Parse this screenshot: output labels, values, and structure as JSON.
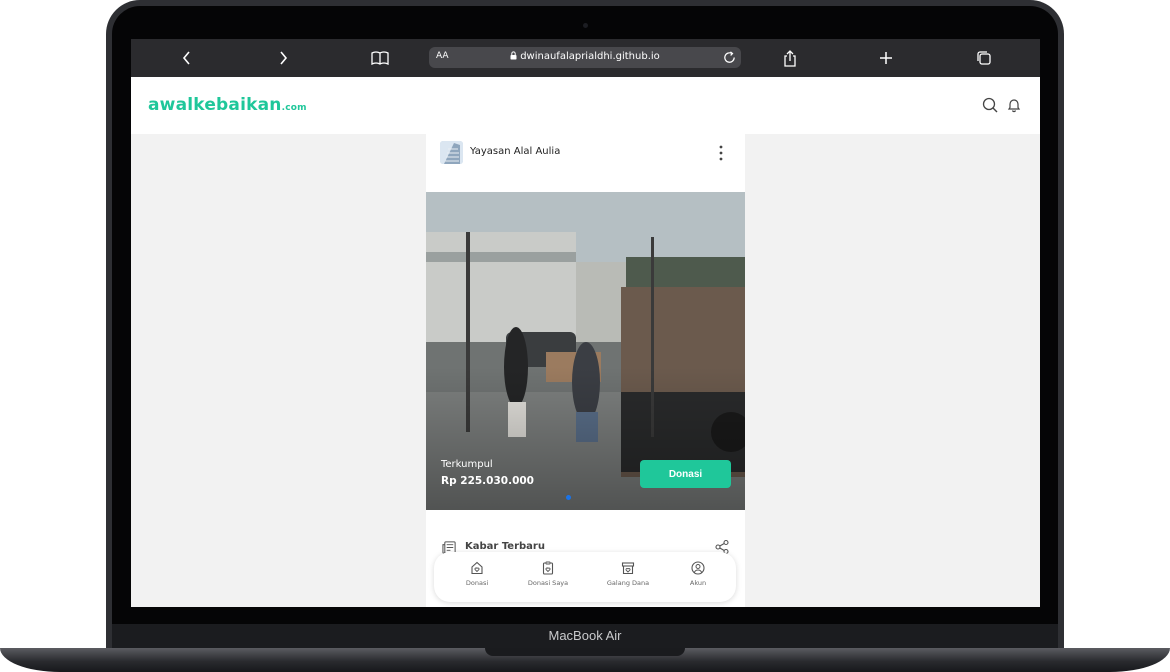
{
  "device": {
    "label": "MacBook Air"
  },
  "browser": {
    "aa_label": "AA",
    "url": "dwinaufalaprialdhi.github.io",
    "icons": [
      "back-icon",
      "forward-icon",
      "book-icon",
      "lock-icon",
      "reload-icon",
      "share-icon",
      "plus-icon",
      "tabs-icon"
    ]
  },
  "site": {
    "logo_main": "awalkebaikan",
    "logo_suffix": ".com",
    "brand_color": "#1fc79a",
    "header_icons": [
      "search-icon",
      "bell-icon"
    ]
  },
  "campaign": {
    "organization": "Yayasan Alal Aulia",
    "collected_label": "Terkumpul",
    "collected_value": "Rp 225.030.000",
    "donate_label": "Donasi"
  },
  "news": {
    "title": "Kabar Terbaru"
  },
  "bottom_nav": [
    {
      "label": "Donasi",
      "icon": "home-heart-icon"
    },
    {
      "label": "Donasi Saya",
      "icon": "clipboard-heart-icon"
    },
    {
      "label": "Galang Dana",
      "icon": "box-heart-icon"
    },
    {
      "label": "Akun",
      "icon": "user-circle-icon"
    }
  ]
}
